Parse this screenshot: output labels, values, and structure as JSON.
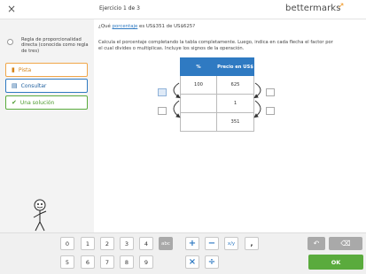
{
  "header": {
    "close_icon": "×",
    "exercise_label": "Ejercicio 1 de 3",
    "brand": "bettermarks"
  },
  "sidebar": {
    "topic": "Regla de proporcionalidad directa (conocida como regla de tres)",
    "buttons": [
      {
        "label": "Pista",
        "icon": "lightbulb-icon"
      },
      {
        "label": "Consultar",
        "icon": "book-icon"
      },
      {
        "label": "Una solución",
        "icon": "check-icon"
      }
    ]
  },
  "question": {
    "prefix": "¿Qué ",
    "link": "porcentaje",
    "suffix": " es US$351 de US$625?"
  },
  "instruction": "Calcula el porcentaje completando la tabla completamente. Luego, indica en cada flecha el factor por el cual divides o multiplicas. Incluye los signos de la operación.",
  "table": {
    "headers": [
      "%",
      "Precio en US$"
    ],
    "rows": [
      [
        "100",
        "625"
      ],
      [
        "",
        "1"
      ],
      [
        "",
        "351"
      ]
    ]
  },
  "keyboard": {
    "row1": [
      "0",
      "1",
      "2",
      "3",
      "4",
      "abc"
    ],
    "row2": [
      "5",
      "6",
      "7",
      "8",
      "9"
    ],
    "ops_row1": [
      "+",
      "−",
      "x/y",
      ","
    ],
    "ops_row2": [
      "×",
      "÷"
    ],
    "undo": "↶",
    "delete": "⌫",
    "ok": "OK"
  },
  "colors": {
    "accent_blue": "#2f7ac2",
    "hint_orange": "#f0a649",
    "ok_green": "#5aab3d"
  }
}
